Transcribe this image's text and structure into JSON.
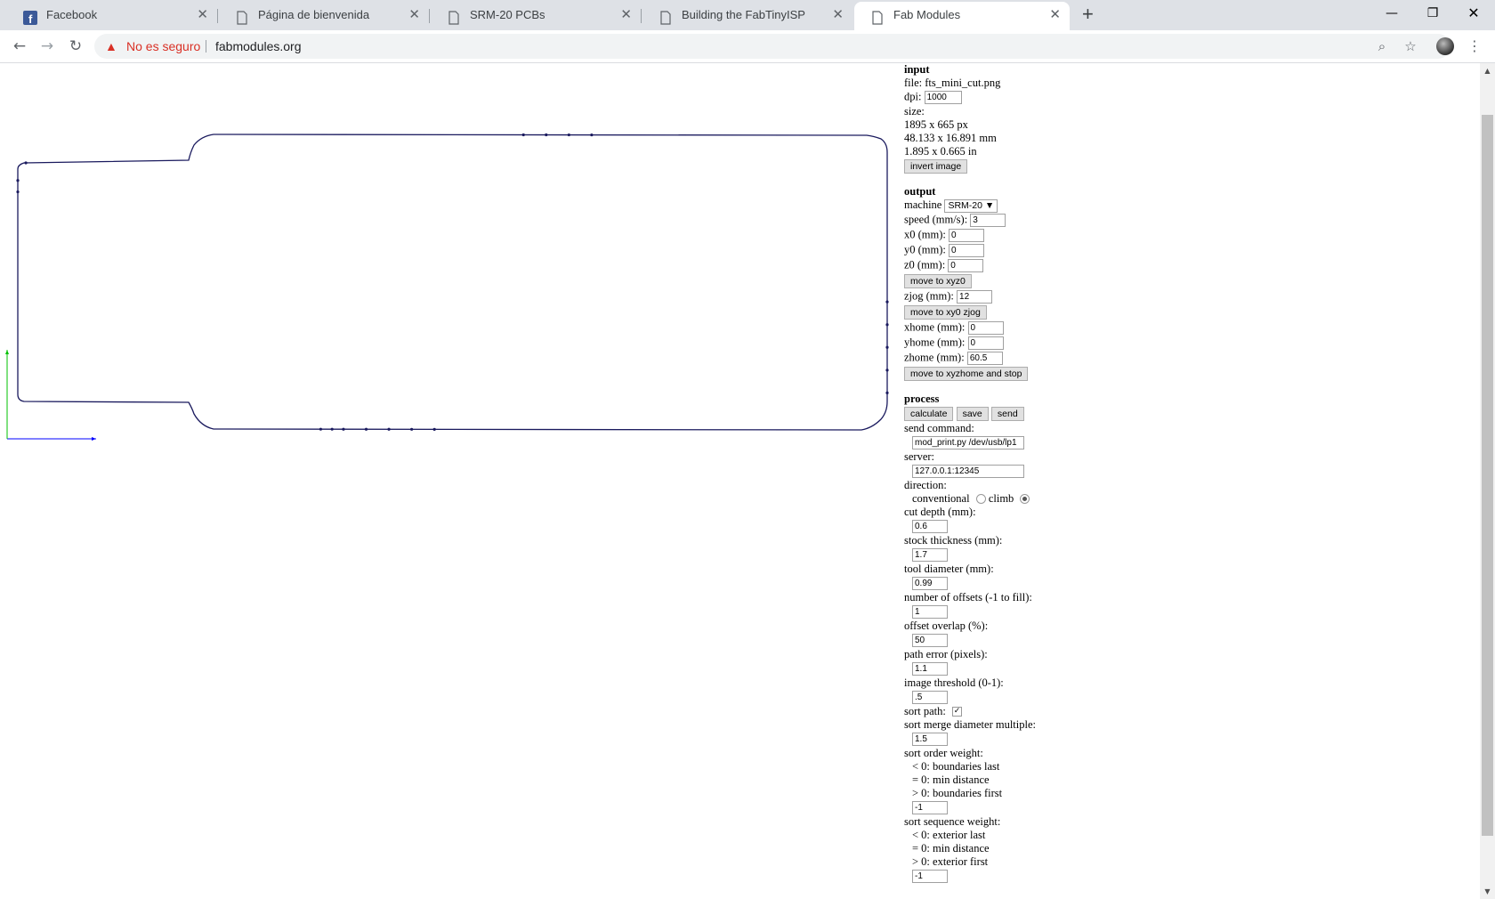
{
  "browser": {
    "tabs": [
      {
        "title": "Facebook",
        "icon": "facebook-icon"
      },
      {
        "title": "Página de bienvenida",
        "icon": "page-icon"
      },
      {
        "title": "SRM-20 PCBs",
        "icon": "page-icon"
      },
      {
        "title": "Building the FabTinyISP",
        "icon": "page-icon"
      },
      {
        "title": "Fab Modules",
        "icon": "page-icon",
        "active": true
      }
    ],
    "security_label": "No es seguro",
    "url": "fabmodules.org"
  },
  "input": {
    "heading": "input",
    "file_label": "file: fts_mini_cut.png",
    "dpi_label": "dpi:",
    "dpi_value": "1000",
    "size_label": "size:",
    "size_px": "1895 x 665 px",
    "size_mm": "48.133 x 16.891 mm",
    "size_in": "1.895 x 0.665 in",
    "invert_button": "invert image"
  },
  "output": {
    "heading": "output",
    "machine_label": "machine",
    "machine_value": "SRM-20",
    "speed_label": "speed (mm/s):",
    "speed_value": "3",
    "x0_label": "x0 (mm):",
    "x0_value": "0",
    "y0_label": "y0 (mm):",
    "y0_value": "0",
    "z0_label": "z0 (mm):",
    "z0_value": "0",
    "move_xyz0_button": "move to xyz0",
    "zjog_label": "zjog (mm):",
    "zjog_value": "12",
    "move_xy0_button": "move to xy0 zjog",
    "xhome_label": "xhome (mm):",
    "xhome_value": "0",
    "yhome_label": "yhome (mm):",
    "yhome_value": "0",
    "zhome_label": "zhome (mm):",
    "zhome_value": "60.5",
    "move_home_button": "move to xyzhome and stop"
  },
  "process": {
    "heading": "process",
    "calculate_button": "calculate",
    "save_button": "save",
    "send_button": "send",
    "send_command_label": "send command:",
    "send_command_value": "mod_print.py /dev/usb/lp1",
    "server_label": "server:",
    "server_value": "127.0.0.1:12345",
    "direction_label": "direction:",
    "conventional_label": "conventional",
    "climb_label": "climb",
    "direction_selected": "climb",
    "cut_depth_label": "cut depth (mm):",
    "cut_depth_value": "0.6",
    "stock_label": "stock thickness (mm):",
    "stock_value": "1.7",
    "tool_label": "tool diameter (mm):",
    "tool_value": "0.99",
    "offsets_label": "number of offsets (-1 to fill):",
    "offsets_value": "1",
    "overlap_label": "offset overlap (%):",
    "overlap_value": "50",
    "path_error_label": "path error (pixels):",
    "path_error_value": "1.1",
    "threshold_label": "image threshold (0-1):",
    "threshold_value": ".5",
    "sort_path_label": "sort path:",
    "sort_path_checked": true,
    "merge_label": "sort merge diameter multiple:",
    "merge_value": "1.5",
    "order_label": "sort order weight:",
    "order_lt": "< 0: boundaries last",
    "order_eq": "= 0: min distance",
    "order_gt": "> 0: boundaries first",
    "order_value": "-1",
    "sequence_label": "sort sequence weight:",
    "seq_lt": "< 0: exterior last",
    "seq_eq": "= 0: min distance",
    "seq_gt": "> 0: exterior first",
    "seq_value": "-1"
  },
  "colors": {
    "toolpath": "#1a1a5e",
    "axis_x": "#0000ff",
    "axis_y": "#00c000",
    "security_warning": "#d93025"
  }
}
